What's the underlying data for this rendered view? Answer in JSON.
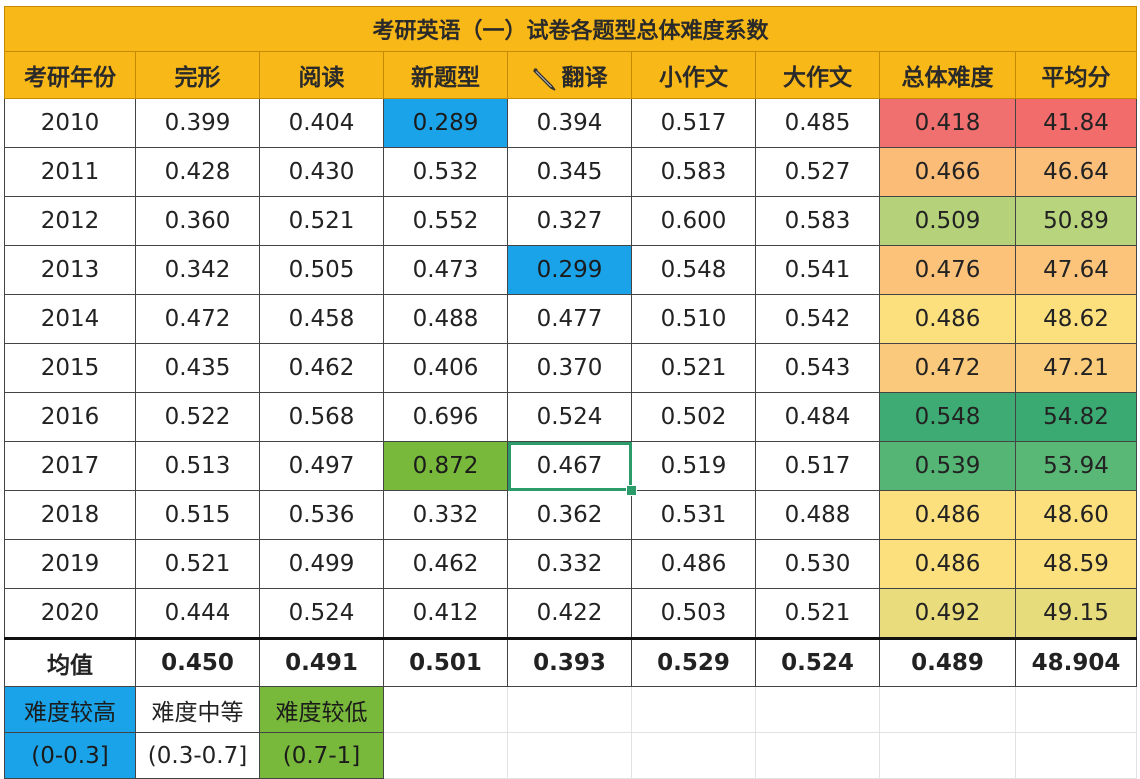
{
  "title": "考研英语（一）试卷各题型总体难度系数",
  "headers": [
    "考研年份",
    "完形",
    "阅读",
    "新题型",
    "翻译",
    "小作文",
    "大作文",
    "总体难度",
    "平均分"
  ],
  "rows": [
    [
      "2010",
      "0.399",
      "0.404",
      "0.289",
      "0.394",
      "0.517",
      "0.485",
      "0.418",
      "41.84"
    ],
    [
      "2011",
      "0.428",
      "0.430",
      "0.532",
      "0.345",
      "0.583",
      "0.527",
      "0.466",
      "46.64"
    ],
    [
      "2012",
      "0.360",
      "0.521",
      "0.552",
      "0.327",
      "0.600",
      "0.583",
      "0.509",
      "50.89"
    ],
    [
      "2013",
      "0.342",
      "0.505",
      "0.473",
      "0.299",
      "0.548",
      "0.541",
      "0.476",
      "47.64"
    ],
    [
      "2014",
      "0.472",
      "0.458",
      "0.488",
      "0.477",
      "0.510",
      "0.542",
      "0.486",
      "48.62"
    ],
    [
      "2015",
      "0.435",
      "0.462",
      "0.406",
      "0.370",
      "0.521",
      "0.543",
      "0.472",
      "47.21"
    ],
    [
      "2016",
      "0.522",
      "0.568",
      "0.696",
      "0.524",
      "0.502",
      "0.484",
      "0.548",
      "54.82"
    ],
    [
      "2017",
      "0.513",
      "0.497",
      "0.872",
      "0.467",
      "0.519",
      "0.517",
      "0.539",
      "53.94"
    ],
    [
      "2018",
      "0.515",
      "0.536",
      "0.332",
      "0.362",
      "0.531",
      "0.488",
      "0.486",
      "48.60"
    ],
    [
      "2019",
      "0.521",
      "0.499",
      "0.462",
      "0.332",
      "0.486",
      "0.530",
      "0.486",
      "48.59"
    ],
    [
      "2020",
      "0.444",
      "0.524",
      "0.412",
      "0.422",
      "0.503",
      "0.521",
      "0.492",
      "49.15"
    ]
  ],
  "mean_row": [
    "均值",
    "0.450",
    "0.491",
    "0.501",
    "0.393",
    "0.529",
    "0.524",
    "0.489",
    "48.904"
  ],
  "legend": {
    "labels": [
      "难度较高",
      "难度中等",
      "难度较低"
    ],
    "ranges": [
      "(0-0.3]",
      "(0.3-0.7]",
      "(0.7-1]"
    ]
  },
  "colors": {
    "header_bg": "#f8b818",
    "high_difficulty": "#1aa3e8",
    "low_difficulty": "#78b83a",
    "selection": "#2b9b6a",
    "overall_difficulty_cells": [
      "#f07070",
      "#fbbc78",
      "#b5d27a",
      "#fcc27a",
      "#fde07e",
      "#fbc97b",
      "#3fab74",
      "#55b574",
      "#fde07e",
      "#fde07e",
      "#e8dc7c"
    ],
    "average_score_cells": [
      "#f26c6c",
      "#fbbf7a",
      "#b8d47c",
      "#fcc47b",
      "#fde07e",
      "#fbcc7c",
      "#3aa972",
      "#5ab877",
      "#fde07e",
      "#fde07e",
      "#e6dc7c"
    ]
  },
  "cell_highlights": {
    "blue": [
      [
        0,
        3
      ],
      [
        3,
        4
      ]
    ],
    "green": [
      [
        7,
        3
      ]
    ]
  },
  "selected_cell": [
    7,
    4
  ],
  "pen_icon": "pen-icon"
}
